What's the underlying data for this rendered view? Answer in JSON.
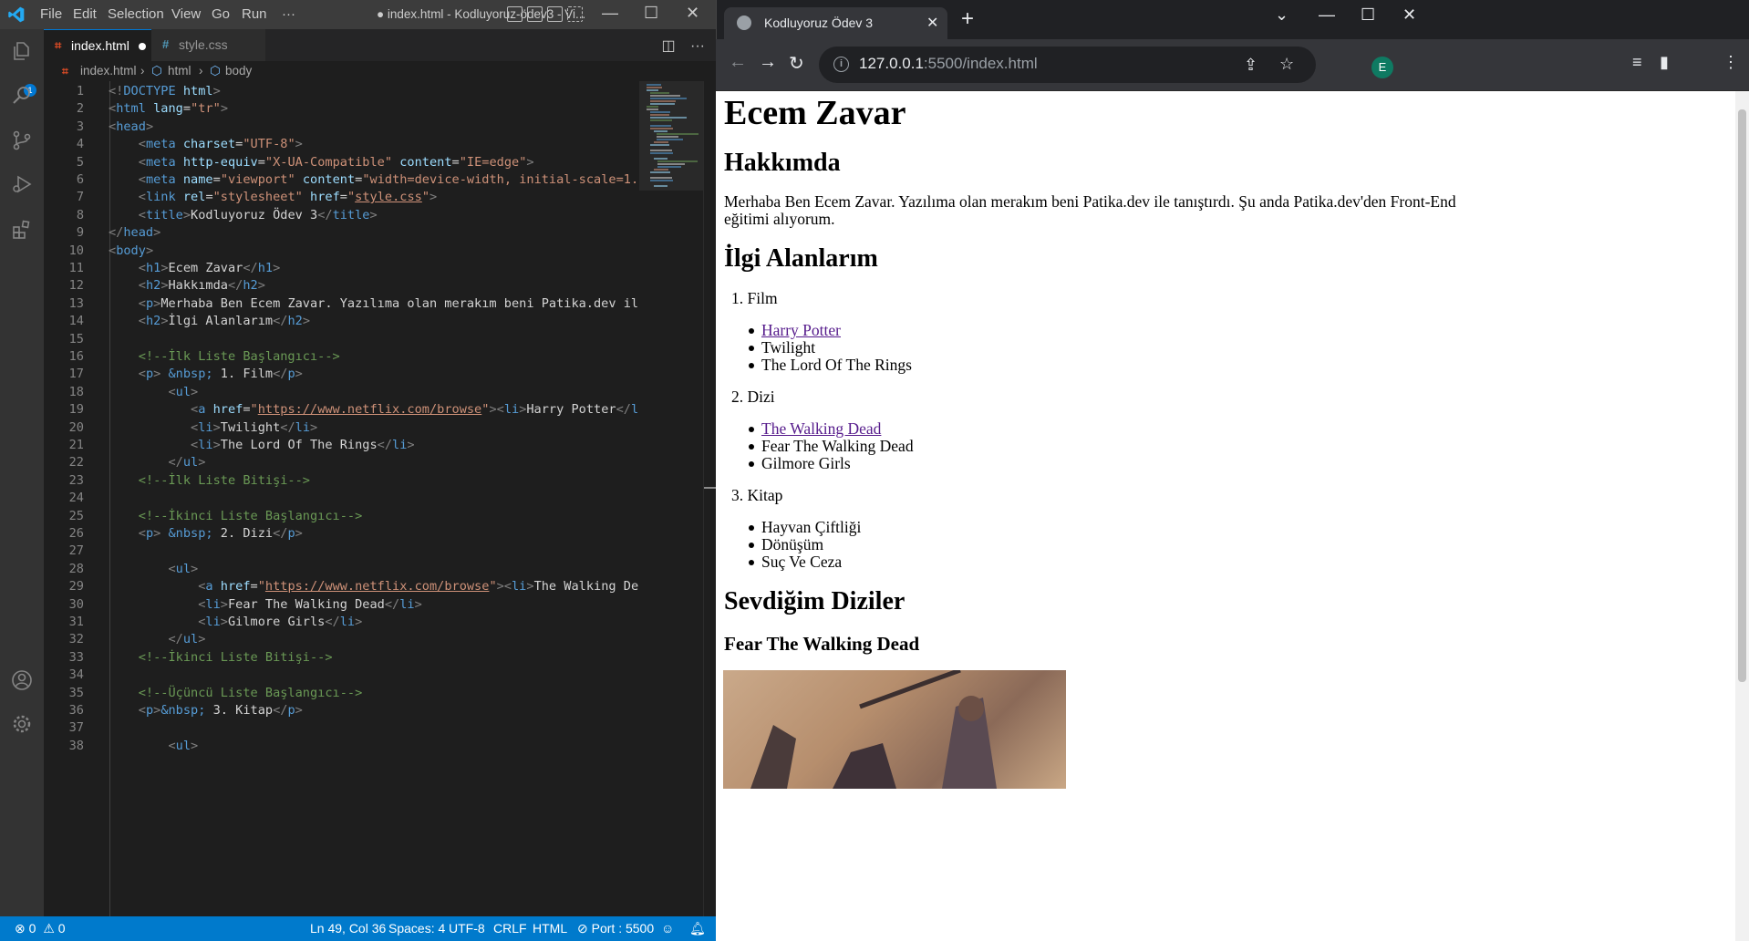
{
  "vscode": {
    "menu": [
      "File",
      "Edit",
      "Selection",
      "View",
      "Go",
      "Run",
      "···"
    ],
    "window_title": "● index.html - Kodluyoruz-ödev3 - Vi...",
    "tabs": [
      {
        "label": "index.html",
        "icon": "html5-icon",
        "icon_glyph": "⌗",
        "active": true,
        "modified": true
      },
      {
        "label": "style.css",
        "icon": "css-icon",
        "icon_glyph": "#",
        "active": false,
        "modified": false
      }
    ],
    "breadcrumb": [
      "index.html",
      "html",
      "body"
    ],
    "code_lines": [
      {
        "n": "1",
        "html": "<span class='p'>&lt;!</span><span class='t'>DOCTYPE</span> <span class='a'>html</span><span class='p'>&gt;</span>"
      },
      {
        "n": "2",
        "html": "<span class='p'>&lt;</span><span class='t'>html</span> <span class='a'>lang</span><span class='x'>=</span><span class='s'>\"tr\"</span><span class='p'>&gt;</span>"
      },
      {
        "n": "3",
        "html": "<span class='p'>&lt;</span><span class='t'>head</span><span class='p'>&gt;</span>"
      },
      {
        "n": "4",
        "html": "    <span class='p'>&lt;</span><span class='t'>meta</span> <span class='a'>charset</span><span class='x'>=</span><span class='s'>\"UTF-8\"</span><span class='p'>&gt;</span>"
      },
      {
        "n": "5",
        "html": "    <span class='p'>&lt;</span><span class='t'>meta</span> <span class='a'>http-equiv</span><span class='x'>=</span><span class='s'>\"X-UA-Compatible\"</span> <span class='a'>content</span><span class='x'>=</span><span class='s'>\"IE=edge\"</span><span class='p'>&gt;</span>"
      },
      {
        "n": "6",
        "html": "    <span class='p'>&lt;</span><span class='t'>meta</span> <span class='a'>name</span><span class='x'>=</span><span class='s'>\"viewport\"</span> <span class='a'>content</span><span class='x'>=</span><span class='s'>\"width=device-width, initial-scale=1.0\"</span><span class='p'>&gt;</span>"
      },
      {
        "n": "7",
        "html": "    <span class='p'>&lt;</span><span class='t'>link</span> <span class='a'>rel</span><span class='x'>=</span><span class='s'>\"stylesheet\"</span> <span class='a'>href</span><span class='x'>=</span><span class='s'>\"<span class='u'>style.css</span>\"</span><span class='p'>&gt;</span>"
      },
      {
        "n": "8",
        "html": "    <span class='p'>&lt;</span><span class='t'>title</span><span class='p'>&gt;</span>Kodluyoruz Ödev 3<span class='p'>&lt;/</span><span class='t'>title</span><span class='p'>&gt;</span>"
      },
      {
        "n": "9",
        "html": "<span class='p'>&lt;/</span><span class='t'>head</span><span class='p'>&gt;</span>"
      },
      {
        "n": "10",
        "html": "<span class='p'>&lt;</span><span class='t'>body</span><span class='p'>&gt;</span>"
      },
      {
        "n": "11",
        "html": "    <span class='p'>&lt;</span><span class='t'>h1</span><span class='p'>&gt;</span>Ecem Zavar<span class='p'>&lt;/</span><span class='t'>h1</span><span class='p'>&gt;</span>"
      },
      {
        "n": "12",
        "html": "    <span class='p'>&lt;</span><span class='t'>h2</span><span class='p'>&gt;</span>Hakkımda<span class='p'>&lt;/</span><span class='t'>h2</span><span class='p'>&gt;</span>"
      },
      {
        "n": "13",
        "html": "    <span class='p'>&lt;</span><span class='t'>p</span><span class='p'>&gt;</span>Merhaba Ben Ecem Zavar. Yazılıma olan merakım beni Patika.dev ile ta"
      },
      {
        "n": "14",
        "html": "    <span class='p'>&lt;</span><span class='t'>h2</span><span class='p'>&gt;</span>İlgi Alanlarım<span class='p'>&lt;/</span><span class='t'>h2</span><span class='p'>&gt;</span>"
      },
      {
        "n": "15",
        "html": ""
      },
      {
        "n": "16",
        "html": "    <span class='c'>&lt;!--İlk Liste Başlangıcı--&gt;</span>"
      },
      {
        "n": "17",
        "html": "    <span class='p'>&lt;</span><span class='t'>p</span><span class='p'>&gt;</span> <span class='t'>&amp;nbsp;</span> 1. Film<span class='p'>&lt;/</span><span class='t'>p</span><span class='p'>&gt;</span>"
      },
      {
        "n": "18",
        "html": "        <span class='p'>&lt;</span><span class='t'>ul</span><span class='p'>&gt;</span>"
      },
      {
        "n": "19",
        "html": "           <span class='p'>&lt;</span><span class='t'>a</span> <span class='a'>href</span><span class='x'>=</span><span class='s'>\"<span class='u'>https://www.netflix.com/browse</span>\"</span><span class='p'>&gt;&lt;</span><span class='t'>li</span><span class='p'>&gt;</span>Harry Potter<span class='p'>&lt;/</span><span class='t'>li</span><span class='p'>&gt;&lt;</span>"
      },
      {
        "n": "20",
        "html": "           <span class='p'>&lt;</span><span class='t'>li</span><span class='p'>&gt;</span>Twilight<span class='p'>&lt;/</span><span class='t'>li</span><span class='p'>&gt;</span>"
      },
      {
        "n": "21",
        "html": "           <span class='p'>&lt;</span><span class='t'>li</span><span class='p'>&gt;</span>The Lord Of The Rings<span class='p'>&lt;/</span><span class='t'>li</span><span class='p'>&gt;</span>"
      },
      {
        "n": "22",
        "html": "        <span class='p'>&lt;/</span><span class='t'>ul</span><span class='p'>&gt;</span>"
      },
      {
        "n": "23",
        "html": "    <span class='c'>&lt;!--İlk Liste Bitişi--&gt;</span>"
      },
      {
        "n": "24",
        "html": ""
      },
      {
        "n": "25",
        "html": "    <span class='c'>&lt;!--İkinci Liste Başlangıcı--&gt;</span>"
      },
      {
        "n": "26",
        "html": "    <span class='p'>&lt;</span><span class='t'>p</span><span class='p'>&gt;</span> <span class='t'>&amp;nbsp;</span> 2. Dizi<span class='p'>&lt;/</span><span class='t'>p</span><span class='p'>&gt;</span>"
      },
      {
        "n": "27",
        "html": ""
      },
      {
        "n": "28",
        "html": "        <span class='p'>&lt;</span><span class='t'>ul</span><span class='p'>&gt;</span>"
      },
      {
        "n": "29",
        "html": "            <span class='p'>&lt;</span><span class='t'>a</span> <span class='a'>href</span><span class='x'>=</span><span class='s'>\"<span class='u'>https://www.netflix.com/browse</span>\"</span><span class='p'>&gt;&lt;</span><span class='t'>li</span><span class='p'>&gt;</span>The Walking Dead<span class='p'>&lt;</span>"
      },
      {
        "n": "30",
        "html": "            <span class='p'>&lt;</span><span class='t'>li</span><span class='p'>&gt;</span>Fear The Walking Dead<span class='p'>&lt;/</span><span class='t'>li</span><span class='p'>&gt;</span>"
      },
      {
        "n": "31",
        "html": "            <span class='p'>&lt;</span><span class='t'>li</span><span class='p'>&gt;</span>Gilmore Girls<span class='p'>&lt;/</span><span class='t'>li</span><span class='p'>&gt;</span>"
      },
      {
        "n": "32",
        "html": "        <span class='p'>&lt;/</span><span class='t'>ul</span><span class='p'>&gt;</span>"
      },
      {
        "n": "33",
        "html": "    <span class='c'>&lt;!--İkinci Liste Bitişi--&gt;</span>"
      },
      {
        "n": "34",
        "html": ""
      },
      {
        "n": "35",
        "html": "    <span class='c'>&lt;!--Üçüncü Liste Başlangıcı--&gt;</span>"
      },
      {
        "n": "36",
        "html": "    <span class='p'>&lt;</span><span class='t'>p</span><span class='p'>&gt;</span><span class='t'>&amp;nbsp;</span> 3. Kitap<span class='p'>&lt;/</span><span class='t'>p</span><span class='p'>&gt;</span>"
      },
      {
        "n": "37",
        "html": ""
      },
      {
        "n": "38",
        "html": "        <span class='p'>&lt;</span><span class='t'>ul</span><span class='p'>&gt;</span>"
      }
    ],
    "status": {
      "errors": "0",
      "warnings": "0",
      "position": "Ln 49, Col 36",
      "spaces": "Spaces: 4",
      "encoding": "UTF-8",
      "eol": "CRLF",
      "language": "HTML",
      "port": "Port : 5500"
    },
    "colors": {
      "statusbar": "#007acc",
      "titlebar": "#3c3c3c",
      "activitybar": "#333333",
      "editor": "#1e1e1e"
    }
  },
  "browser": {
    "tab_title": "Kodluyoruz Ödev 3",
    "url_host": "127.0.0.1",
    "url_rest": ":5500/index.html",
    "profile_initial": "E",
    "page": {
      "h1": "Ecem Zavar",
      "about_heading": "Hakkımda",
      "about_line1": "Merhaba Ben Ecem Zavar. Yazılıma olan merakım beni Patika.dev ile tanıştırdı. Şu anda Patika.dev'den Front-End",
      "about_line2": "eğitimi alıyorum.",
      "interests_heading": "İlgi Alanlarım",
      "film_label": "1. Film",
      "film_items": [
        "Harry Potter",
        "Twilight",
        "The Lord Of The Rings"
      ],
      "dizi_label": "2. Dizi",
      "dizi_items": [
        "The Walking Dead",
        "Fear The Walking Dead",
        "Gilmore Girls"
      ],
      "kitap_label": "3. Kitap",
      "kitap_items": [
        "Hayvan Çiftliği",
        "Dönüşüm",
        "Suç Ve Ceza"
      ],
      "favorites_heading": "Sevdiğim Diziler",
      "show_title": "Fear The Walking Dead"
    }
  }
}
